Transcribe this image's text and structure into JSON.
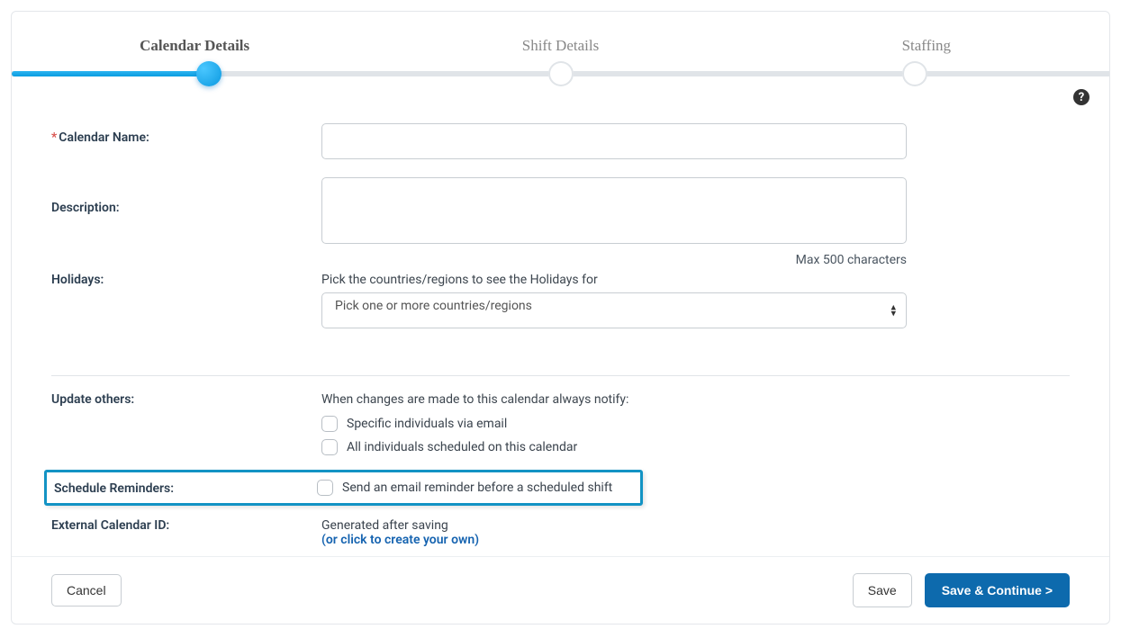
{
  "steps": {
    "s1": "Calendar Details",
    "s2": "Shift Details",
    "s3": "Staffing"
  },
  "labels": {
    "calendar_name": "Calendar Name:",
    "description": "Description:",
    "holidays": "Holidays:",
    "update_others": "Update others:",
    "schedule_reminders": "Schedule Reminders:",
    "external_cal_id": "External Calendar ID:"
  },
  "hints": {
    "max_chars": "Max 500 characters",
    "holidays_help": "Pick the countries/regions to see the Holidays for",
    "update_help": "When changes are made to this calendar always notify:",
    "generated": "Generated after saving",
    "create_own": "(or click to create your own)"
  },
  "options": {
    "holidays_placeholder": "Pick one or more countries/regions",
    "notify_specific": "Specific individuals via email",
    "notify_all": "All individuals scheduled on this calendar",
    "reminder": "Send an email reminder before a scheduled shift"
  },
  "buttons": {
    "cancel": "Cancel",
    "save": "Save",
    "save_continue": "Save & Continue >"
  },
  "values": {
    "calendar_name": "",
    "description": ""
  }
}
